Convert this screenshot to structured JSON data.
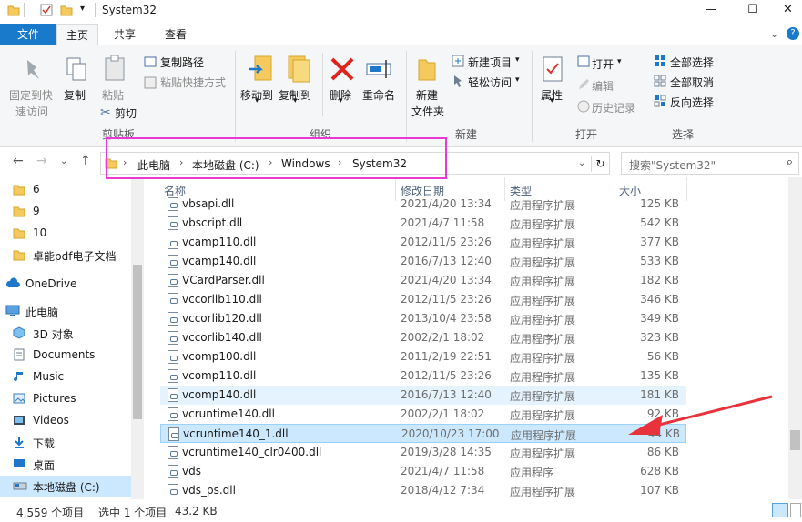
{
  "window": {
    "title": "System32",
    "minimize": "—",
    "maximize": "☐",
    "close": "✕"
  },
  "tabs": {
    "file": "文件",
    "home": "主页",
    "share": "共享",
    "view": "查看"
  },
  "ribbon": {
    "clipboard": {
      "pin": "固定到快",
      "pin2": "速访问",
      "copy": "复制",
      "paste": "粘贴",
      "copy_path": "复制路径",
      "paste_shortcut": "粘贴快捷方式",
      "cut": "剪切",
      "group": "剪贴板"
    },
    "organize": {
      "move_to": "移动到",
      "copy_to": "复制到",
      "delete": "删除",
      "rename": "重命名",
      "group": "组织"
    },
    "new": {
      "new_folder": "新建",
      "new_folder2": "文件夹",
      "new_item": "新建项目",
      "easy_access": "轻松访问",
      "group": "新建"
    },
    "open": {
      "properties": "属性",
      "open": "打开",
      "edit": "编辑",
      "history": "历史记录",
      "group": "打开"
    },
    "select": {
      "select_all": "全部选择",
      "select_none": "全部取消",
      "invert": "反向选择",
      "group": "选择"
    }
  },
  "address": {
    "crumbs": [
      "此电脑",
      "本地磁盘 (C:)",
      "Windows",
      "System32"
    ],
    "search_placeholder": "搜索\"System32\""
  },
  "navpane": {
    "items": [
      "6",
      "9",
      "10",
      "卓能pdf电子文档",
      "OneDrive",
      "此电脑",
      "3D 对象",
      "Documents",
      "Music",
      "Pictures",
      "Videos",
      "下载",
      "桌面",
      "本地磁盘 (C:)"
    ]
  },
  "columns": {
    "name": "名称",
    "date": "修改日期",
    "type": "类型",
    "size": "大小"
  },
  "files": [
    {
      "name": "vbsapi.dll",
      "date": "2021/4/20 13:34",
      "type": "应用程序扩展",
      "size": "125 KB"
    },
    {
      "name": "vbscript.dll",
      "date": "2021/4/7 11:58",
      "type": "应用程序扩展",
      "size": "542 KB"
    },
    {
      "name": "vcamp110.dll",
      "date": "2012/11/5 23:26",
      "type": "应用程序扩展",
      "size": "377 KB"
    },
    {
      "name": "vcamp140.dll",
      "date": "2016/7/13 12:40",
      "type": "应用程序扩展",
      "size": "533 KB"
    },
    {
      "name": "VCardParser.dll",
      "date": "2021/4/20 13:34",
      "type": "应用程序扩展",
      "size": "182 KB"
    },
    {
      "name": "vccorlib110.dll",
      "date": "2012/11/5 23:26",
      "type": "应用程序扩展",
      "size": "346 KB"
    },
    {
      "name": "vccorlib120.dll",
      "date": "2013/10/4 23:58",
      "type": "应用程序扩展",
      "size": "349 KB"
    },
    {
      "name": "vccorlib140.dll",
      "date": "2002/2/1 18:02",
      "type": "应用程序扩展",
      "size": "323 KB"
    },
    {
      "name": "vcomp100.dll",
      "date": "2011/2/19 22:51",
      "type": "应用程序扩展",
      "size": "56 KB"
    },
    {
      "name": "vcomp110.dll",
      "date": "2012/11/5 23:26",
      "type": "应用程序扩展",
      "size": "135 KB"
    },
    {
      "name": "vcomp140.dll",
      "date": "2016/7/13 12:40",
      "type": "应用程序扩展",
      "size": "181 KB"
    },
    {
      "name": "vcruntime140.dll",
      "date": "2002/2/1 18:02",
      "type": "应用程序扩展",
      "size": "92 KB"
    },
    {
      "name": "vcruntime140_1.dll",
      "date": "2020/10/23 17:00",
      "type": "应用程序扩展",
      "size": "44 KB"
    },
    {
      "name": "vcruntime140_clr0400.dll",
      "date": "2019/3/28 14:35",
      "type": "应用程序扩展",
      "size": "86 KB"
    },
    {
      "name": "vds",
      "date": "2021/4/7 11:58",
      "type": "应用程序",
      "size": "628 KB"
    },
    {
      "name": "vds_ps.dll",
      "date": "2018/4/12 7:34",
      "type": "应用程序扩展",
      "size": "107 KB"
    }
  ],
  "status": {
    "count": "4,559 个项目",
    "selected": "选中 1 个项目",
    "size": "43.2 KB"
  },
  "colors": {
    "accent": "#1979ca",
    "highlight_box": "#e838d8",
    "arrow": "#e8323c",
    "selection": "#cce8ff"
  }
}
